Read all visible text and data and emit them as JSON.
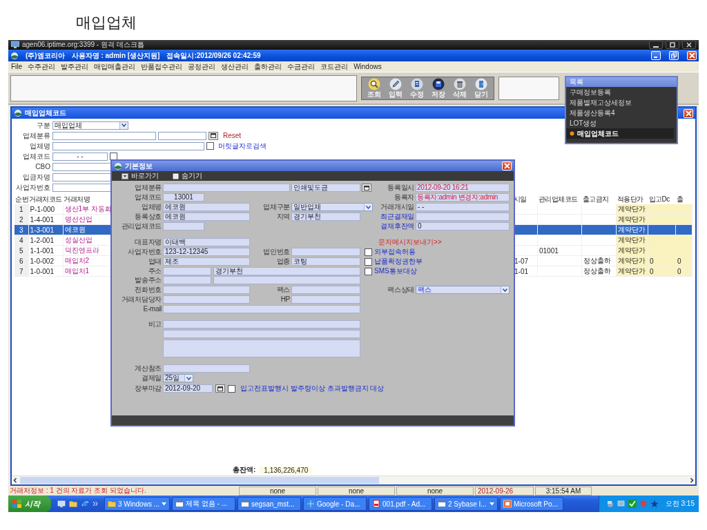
{
  "slide_title": "매입업체",
  "remote_title": "agen06.iptime.org:3399 - 원격 데스크톱",
  "app_title": {
    "company": "(주)엠코리아",
    "user": "사용자명 : admin [생산지원]",
    "login": "접속일시:2012/09/26  02:42:59"
  },
  "menu": [
    "File",
    "수주관리",
    "발주관리",
    "매입매출관리",
    "반품접수관리",
    "공정관리",
    "생산관리",
    "출하관리",
    "수금관리",
    "코드관리",
    "Windows"
  ],
  "toolbar": [
    "조회",
    "입력",
    "수정",
    "저장",
    "삭제",
    "닫기"
  ],
  "nav_panel": {
    "title": "목록",
    "items": [
      {
        "label": "구매정보등록",
        "selected": false
      },
      {
        "label": "제품별재고상세정보",
        "selected": false
      },
      {
        "label": "제품생산등록4",
        "selected": false
      },
      {
        "label": "LOT생성",
        "selected": false
      },
      {
        "label": "매입업체코드",
        "selected": true
      }
    ]
  },
  "mdi_window": {
    "title": "매입업체코드"
  },
  "search_form": {
    "division": {
      "label": "구분",
      "value": "매입업체"
    },
    "category": {
      "label": "업체분류"
    },
    "reset": "Reset",
    "name": {
      "label": "업체명"
    },
    "initial_search": {
      "label": "머릿글자로검색",
      "checked": false
    },
    "code": {
      "label": "업체코드",
      "value": "- -"
    },
    "split_search": {
      "checked": false
    },
    "cbo": {
      "label": "CBO"
    },
    "depositor": {
      "label": "입금자명"
    },
    "biz_no": {
      "label": "사업자번호"
    }
  },
  "grid": {
    "columns_left": [
      "순번",
      "거래처코드",
      "거래처명"
    ],
    "columns_right": [
      "시일",
      "관리업체코드",
      "출고금지",
      "적용단가",
      "입고Dc",
      "출"
    ],
    "rows": [
      {
        "no": "1",
        "code": "P-1-000",
        "name": "생산1부 자동화",
        "price": "계약단가",
        "selected": false
      },
      {
        "no": "2",
        "code": "1-4-001",
        "name": "명선산업",
        "price": "계약단가",
        "selected": false
      },
      {
        "no": "3",
        "code": "1-3-001",
        "name": "에코원",
        "price": "계약단가",
        "selected": true
      },
      {
        "no": "4",
        "code": "1-2-001",
        "name": "성실산업",
        "price": "계약단가",
        "selected": false
      },
      {
        "no": "5",
        "code": "1-1-001",
        "name": "덕진엔프라",
        "mgmt_code": "01001",
        "price": "계약단가",
        "selected": false
      },
      {
        "no": "6",
        "code": "1-0-002",
        "name": "매입처2",
        "start_date": "1-07",
        "ship_block": "정상출하",
        "price": "계약단가",
        "in_dc": "0",
        "out": "0",
        "selected": false
      },
      {
        "no": "7",
        "code": "1-0-001",
        "name": "매입처1",
        "start_date": "1-01",
        "ship_block": "정상출하",
        "price": "계약단가",
        "in_dc": "0",
        "out": "0",
        "selected": false
      }
    ]
  },
  "total": {
    "label": "총잔액:",
    "value": "1,136,226,470"
  },
  "dialog": {
    "title": "기본정보",
    "shortcut": "바로가기",
    "hide": "숨기기",
    "category": {
      "label": "업체분류"
    },
    "category_name": {
      "value": "인쇄및도금"
    },
    "reg_time": {
      "label": "등록일시",
      "value": "2012-09-20 16:21"
    },
    "code": {
      "label": "업체코드",
      "value": "13001"
    },
    "registrant": {
      "label": "등록자",
      "value": "등록자:admin 변경자:admin"
    },
    "name": {
      "label": "업체명",
      "value": "에코원"
    },
    "type": {
      "label": "업체구분",
      "value": "일반업체"
    },
    "start_date": {
      "label": "거래개시일",
      "value": "- -"
    },
    "trade_name": {
      "label": "등록상호",
      "value": "에코원"
    },
    "region": {
      "label": "지역",
      "value": "경기부천"
    },
    "last_pay": {
      "label": "최근결재일"
    },
    "mgmt_code": {
      "label": "관리업체코드"
    },
    "balance": {
      "label": "결재후잔액",
      "value": "0"
    },
    "ceo": {
      "label": "대표자명",
      "value": "이태백"
    },
    "sms_link": "문자메시지보내기>>",
    "biz_no": {
      "label": "사업자번호",
      "value": "123-12-12345"
    },
    "corp_no": {
      "label": "법인번호"
    },
    "external": {
      "label": "외부접속허용",
      "checked": false
    },
    "biz_type": {
      "label": "업태",
      "value": "제조"
    },
    "biz_item": {
      "label": "업종",
      "value": "코팅"
    },
    "confirm": {
      "label": "납품확정권한부",
      "checked": false
    },
    "address": {
      "label": "주소",
      "value": "경기부천"
    },
    "sms_target": {
      "label": "SMS통보대상",
      "checked": false
    },
    "ship_address": {
      "label": "발송주소"
    },
    "phone": {
      "label": "전화번호"
    },
    "fax": {
      "label": "팩스"
    },
    "fax_status": {
      "label": "팩스상태",
      "value": "팩스"
    },
    "contact": {
      "label": "거래처담당자"
    },
    "hp": {
      "label": "HP"
    },
    "email": {
      "label": "E-mail"
    },
    "note": {
      "label": "비고"
    },
    "calc_ref": {
      "label": "계산참조"
    },
    "pay_day": {
      "label": "결제일",
      "value": "25일"
    },
    "ledger_close": {
      "label": "장부마감",
      "value": "2012-09-20"
    },
    "over_issue": {
      "label": "입고전표발행시 발주량이상 초과발행금지 대상",
      "checked": false
    }
  },
  "status_bar": {
    "message": "거래처정보 : 1 건의 자료가 조회 되었습니다.",
    "cells": [
      "none",
      "none",
      "none"
    ],
    "date": "2012-09-26",
    "time": "3:15:54 AM"
  },
  "taskbar": {
    "start": "시작",
    "tasks": [
      {
        "label": "3 Windows ...",
        "grouped": true
      },
      {
        "label": "제목 없음 - ...",
        "grouped": false
      },
      {
        "label": "segsan_mst...",
        "grouped": false
      },
      {
        "label": "Google - Da...",
        "grouped": false
      },
      {
        "label": "001.pdf - Ad...",
        "grouped": false
      },
      {
        "label": "2 Sybase I...",
        "grouped": true
      },
      {
        "label": "Microsoft Po...",
        "grouped": false
      }
    ],
    "clock": "오전 3:15"
  }
}
